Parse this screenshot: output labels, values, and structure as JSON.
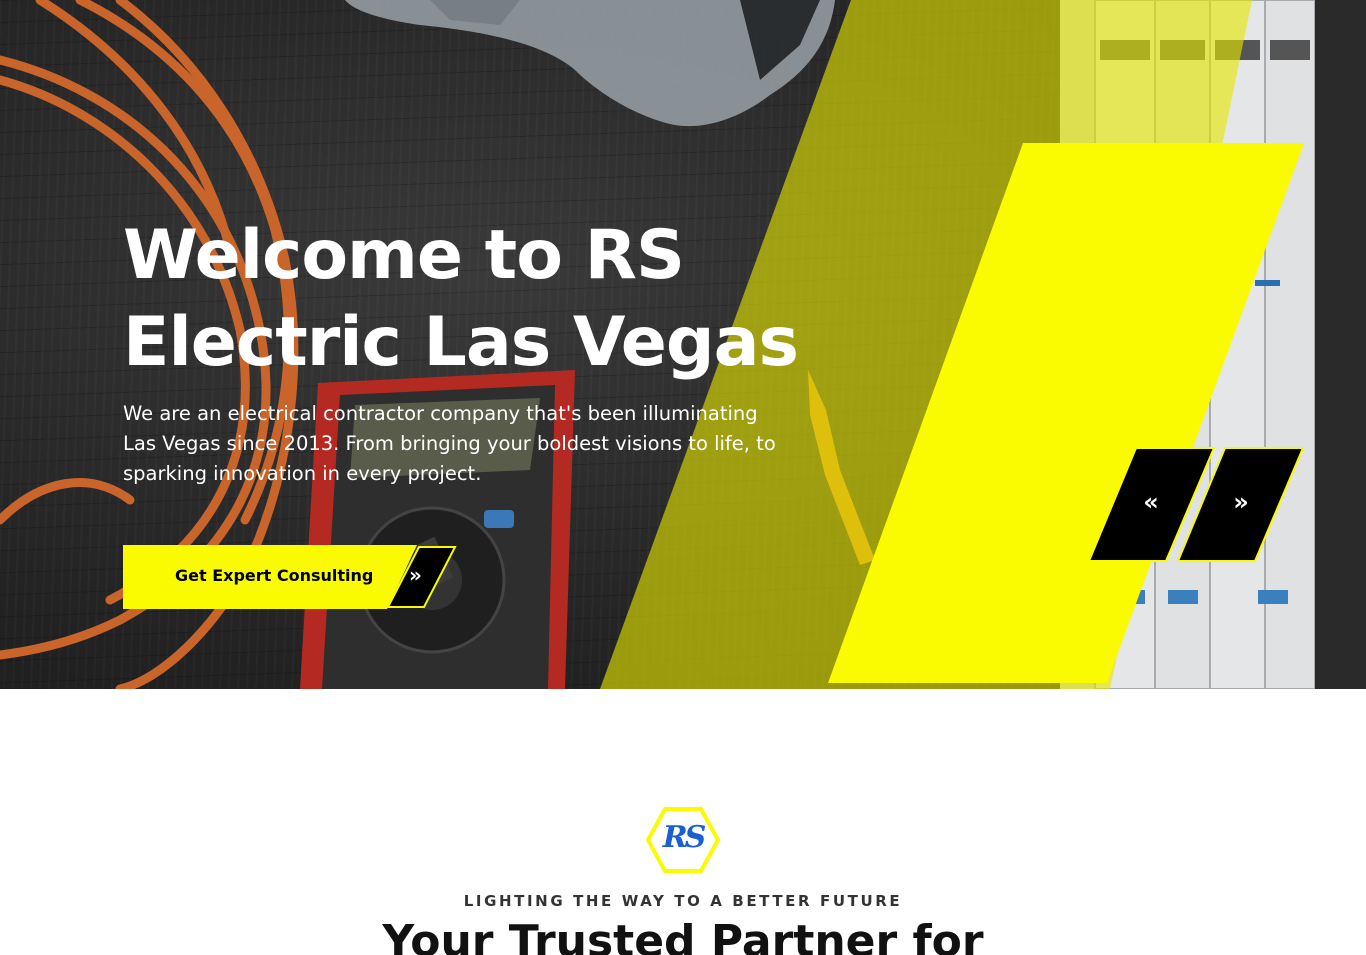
{
  "colors": {
    "accent_yellow": "#FAFA00",
    "dark": "#000000",
    "logo_blue": "#1B5FD1",
    "text_white": "#FFFFFF"
  },
  "hero": {
    "title": "Welcome to RS Electric Las Vegas",
    "description": "We are an electrical contractor company that's been illuminating Las Vegas since 2013. From bringing your boldest visions to life, to sparking innovation in every project.",
    "cta_label": "Get Expert Consulting",
    "cta_icon": "double-chevron-right-icon",
    "cta_glyph": "»",
    "prev_icon": "double-chevron-left-icon",
    "prev_glyph": "«",
    "next_icon": "double-chevron-right-icon",
    "next_glyph": "»"
  },
  "about": {
    "logo_text": "RS",
    "tagline": "LIGHTING THE WAY TO A BETTER FUTURE",
    "heading": "Your Trusted Partner for"
  }
}
